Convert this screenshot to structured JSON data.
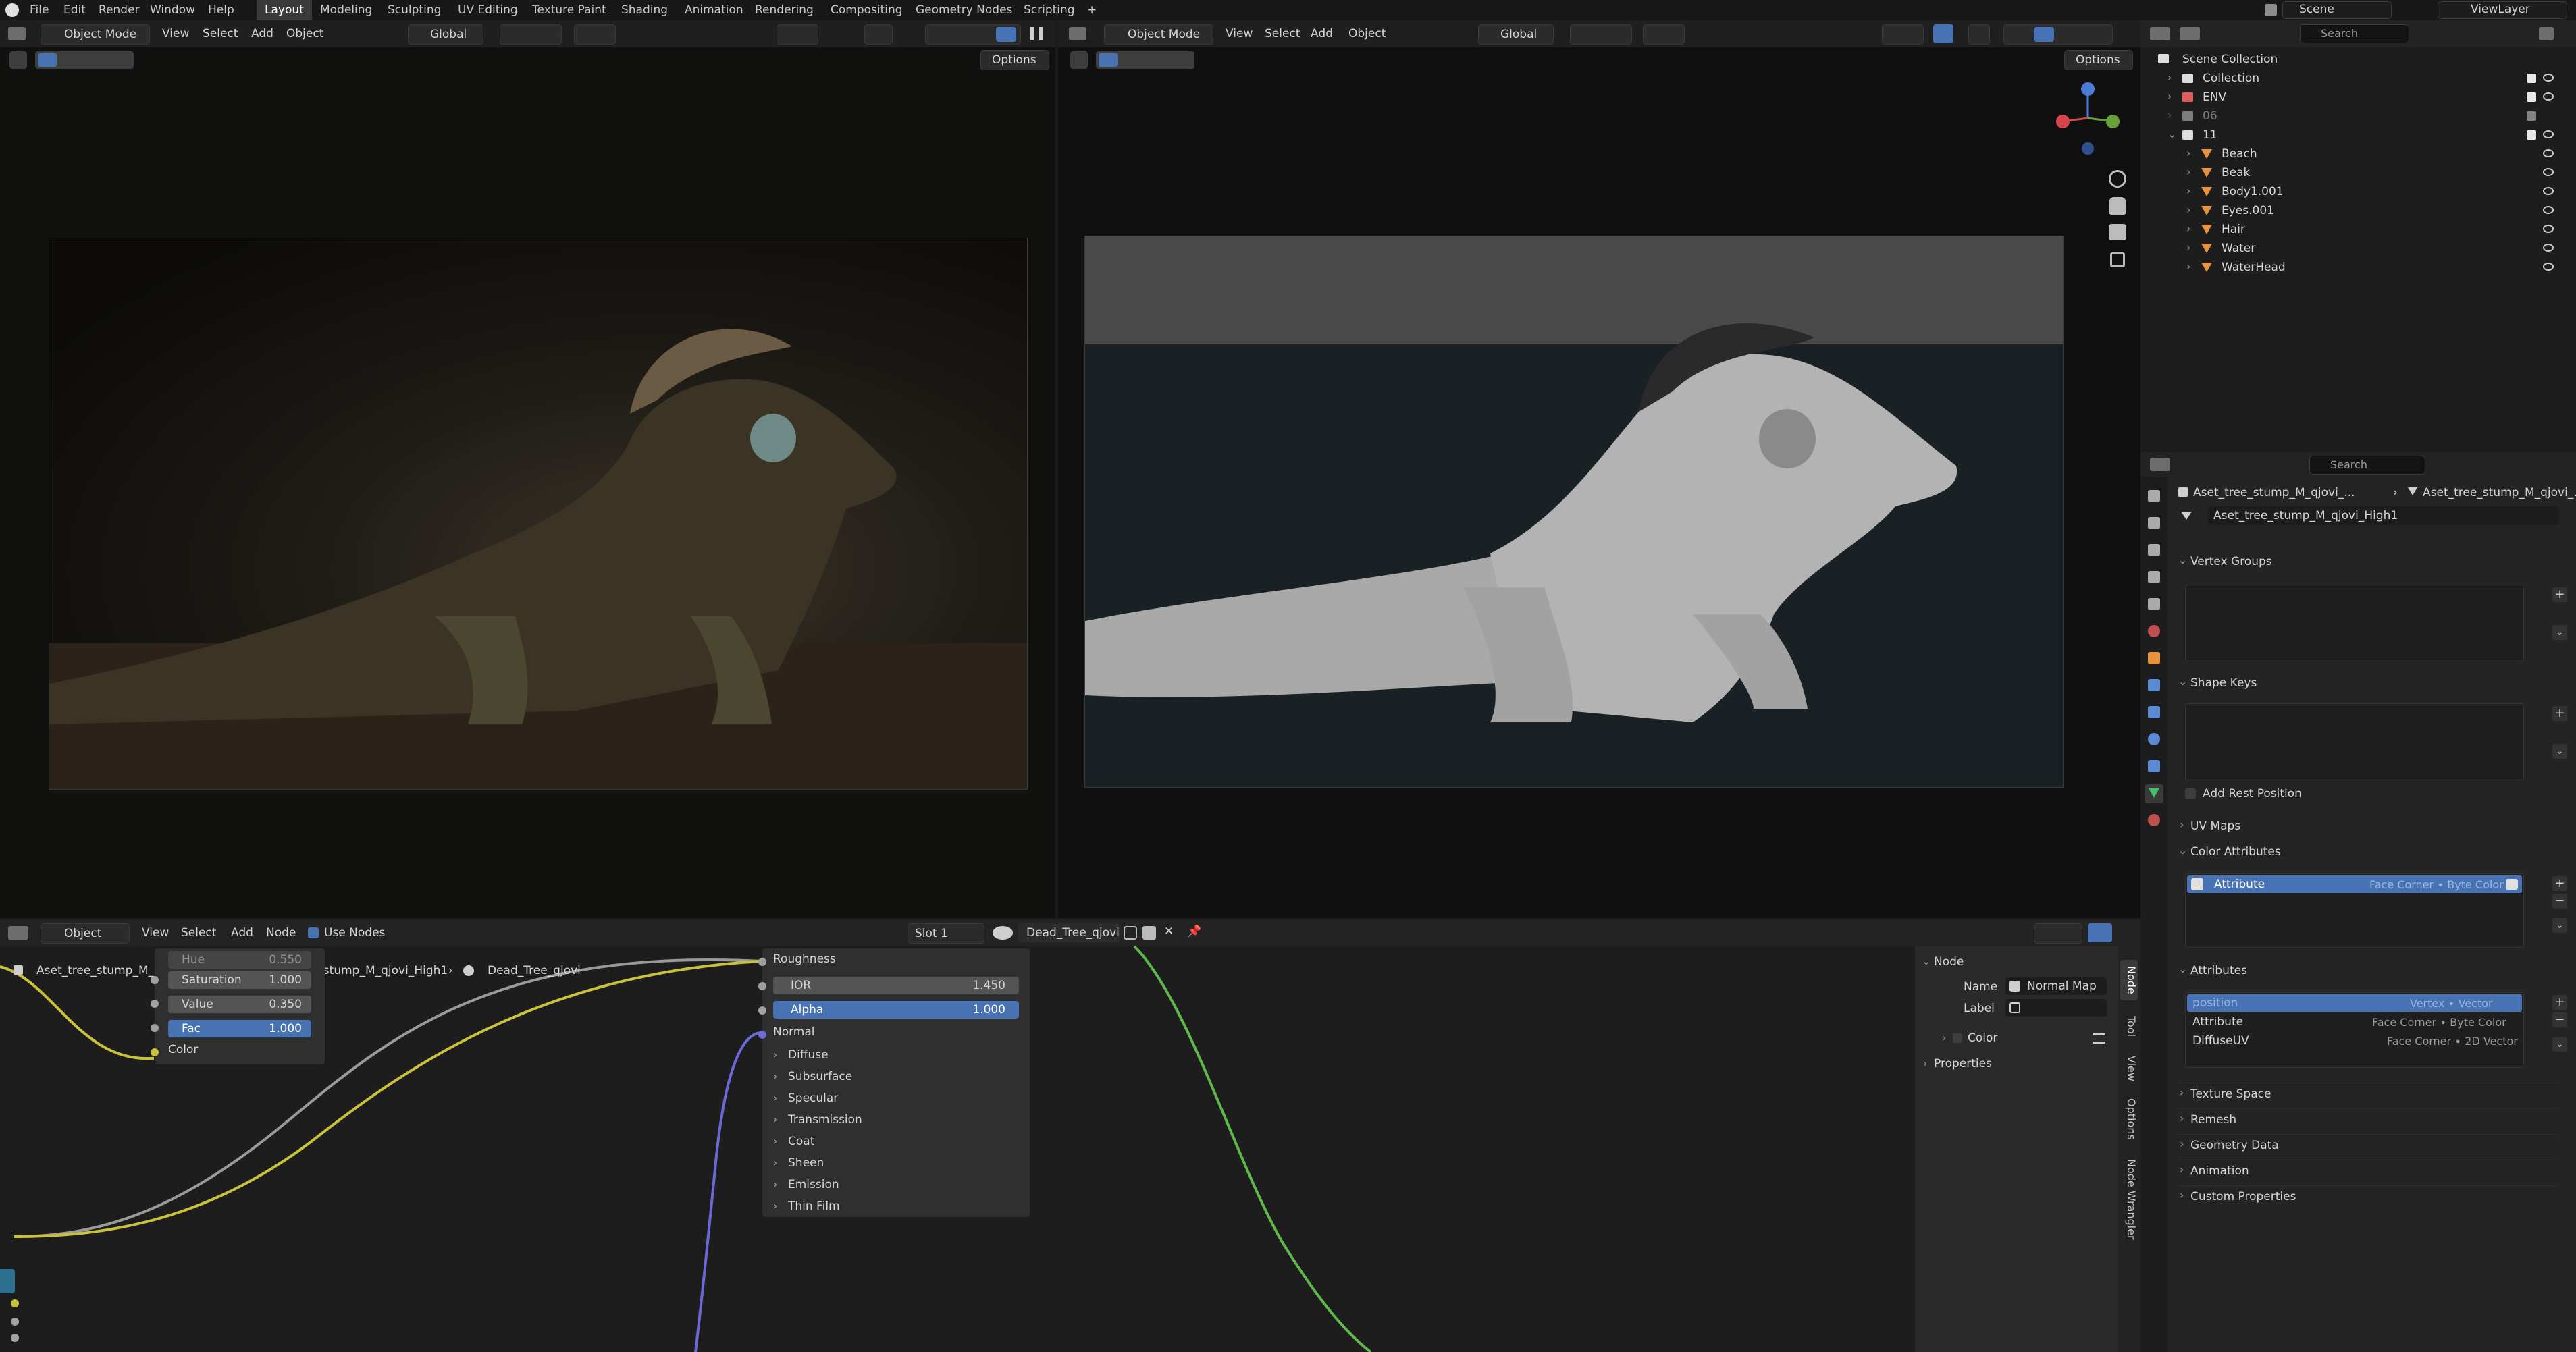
{
  "topbar": {
    "menus": [
      "File",
      "Edit",
      "Render",
      "Window",
      "Help"
    ],
    "workspaces": [
      "Layout",
      "Modeling",
      "Sculpting",
      "UV Editing",
      "Texture Paint",
      "Shading",
      "Animation",
      "Rendering",
      "Compositing",
      "Geometry Nodes",
      "Scripting"
    ],
    "active_workspace": "Layout",
    "scene": "Scene",
    "viewlayer": "ViewLayer"
  },
  "viewport_left": {
    "mode": "Object Mode",
    "menus": [
      "View",
      "Select",
      "Add",
      "Object"
    ],
    "orientation": "Global",
    "options": "Options"
  },
  "viewport_right": {
    "mode": "Object Mode",
    "menus": [
      "View",
      "Select",
      "Add",
      "Object"
    ],
    "orientation": "Global",
    "options": "Options"
  },
  "outliner": {
    "search_placeholder": "Search",
    "root": "Scene Collection",
    "items": [
      {
        "label": "Collection",
        "level": 1
      },
      {
        "label": "ENV",
        "level": 1
      },
      {
        "label": "06",
        "level": 1
      },
      {
        "label": "11",
        "level": 1
      },
      {
        "label": "Beach",
        "level": 2
      },
      {
        "label": "Beak",
        "level": 2
      },
      {
        "label": "Body1.001",
        "level": 2
      },
      {
        "label": "Eyes.001",
        "level": 2
      },
      {
        "label": "Hair",
        "level": 2
      },
      {
        "label": "Water",
        "level": 2
      },
      {
        "label": "WaterHead",
        "level": 2
      }
    ]
  },
  "properties": {
    "search_placeholder": "Search",
    "breadcrumb_a": "Aset_tree_stump_M_qjovi_...",
    "breadcrumb_b": "Aset_tree_stump_M_qjovi_...",
    "mesh_name": "Aset_tree_stump_M_qjovi_High1",
    "vertex_groups": "Vertex Groups",
    "shape_keys": "Shape Keys",
    "add_rest_position": "Add Rest Position",
    "uv_maps": "UV Maps",
    "color_attributes": "Color Attributes",
    "color_attr_name": "Attribute",
    "color_attr_type": "Face Corner ∙ Byte Color",
    "attributes": "Attributes",
    "attr_rows": [
      {
        "name": "position",
        "type": "Vertex ∙ Vector"
      },
      {
        "name": "Attribute",
        "type": "Face Corner ∙ Byte Color"
      },
      {
        "name": "DiffuseUV",
        "type": "Face Corner ∙ 2D Vector"
      }
    ],
    "collapsed": [
      "Texture Space",
      "Remesh",
      "Geometry Data",
      "Animation",
      "Custom Properties"
    ]
  },
  "node_editor": {
    "editor_type": "Object",
    "menus": [
      "View",
      "Select",
      "Add",
      "Node"
    ],
    "use_nodes": "Use Nodes",
    "slot": "Slot 1",
    "material": "Dead_Tree_qjovi",
    "breadcrumb": [
      "Aset_tree_stump_M_qjovi_High1",
      "Aset_tree_stump_M_qjovi_High1",
      "Dead_Tree_qjovi"
    ],
    "hsv_node": {
      "hue_label": "Hue",
      "hue": "0.550",
      "saturation_label": "Saturation",
      "saturation": "1.000",
      "value_label": "Value",
      "value": "0.350",
      "fac_label": "Fac",
      "fac": "1.000",
      "color_label": "Color"
    },
    "bsdf_node": {
      "roughness": "Roughness",
      "ior_label": "IOR",
      "ior": "1.450",
      "alpha_label": "Alpha",
      "alpha": "1.000",
      "normal": "Normal",
      "panels": [
        "Diffuse",
        "Subsurface",
        "Specular",
        "Transmission",
        "Coat",
        "Sheen",
        "Emission",
        "Thin Film"
      ]
    },
    "sidebar": {
      "section": "Node",
      "name_label": "Name",
      "name_value": "Normal Map",
      "label_label": "Label",
      "color": "Color",
      "properties": "Properties",
      "tabs": [
        "Node",
        "Tool",
        "View",
        "Options",
        "Node Wrangler"
      ]
    }
  }
}
